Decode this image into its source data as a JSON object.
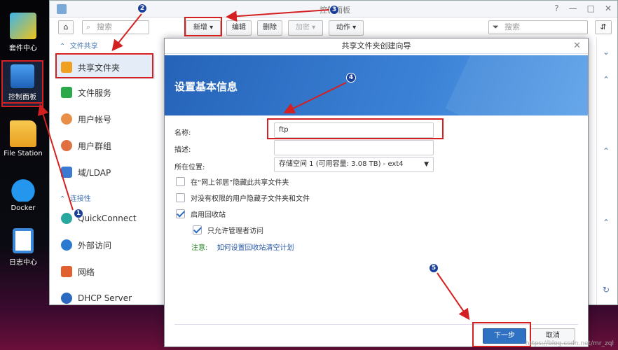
{
  "desktop": [
    {
      "label": "套件中心",
      "icon": "package-center-icon",
      "color": "#f0c419"
    },
    {
      "label": "控制面板",
      "icon": "control-panel-icon",
      "color": "#2e7fd6"
    },
    {
      "label": "File Station",
      "icon": "folder-icon",
      "color": "#f2b632"
    },
    {
      "label": "Docker",
      "icon": "docker-whale-icon",
      "color": "#2496ed"
    },
    {
      "label": "日志中心",
      "icon": "log-center-icon",
      "color": "#3a86d8"
    }
  ],
  "window": {
    "title": "控制面板",
    "controls": [
      "?",
      "—",
      "□",
      "✕"
    ]
  },
  "toolbar": {
    "search_placeholder": "搜索",
    "buttons": [
      {
        "label": "新增 ▾"
      },
      {
        "label": "编辑"
      },
      {
        "label": "删除"
      },
      {
        "label": "加密 ▾"
      },
      {
        "label": "动作 ▾"
      }
    ],
    "filter_placeholder": "搜索"
  },
  "sidebar": {
    "sections": [
      "文件共享",
      "连接性"
    ],
    "items": [
      {
        "label": "共享文件夹",
        "color": "#f0a020"
      },
      {
        "label": "文件服务",
        "color": "#2aa84a"
      },
      {
        "label": "用户帐号",
        "color": "#e8904a"
      },
      {
        "label": "用户群组",
        "color": "#e07040"
      },
      {
        "label": "域/LDAP",
        "color": "#3a7ad0"
      },
      {
        "label": "QuickConnect",
        "color": "#2aa8a0"
      },
      {
        "label": "外部访问",
        "color": "#2a7ad0"
      },
      {
        "label": "网络",
        "color": "#e06030"
      },
      {
        "label": "DHCP Server",
        "color": "#2a6ac0"
      }
    ]
  },
  "dialog": {
    "title": "共享文件夹创建向导",
    "banner_heading": "设置基本信息",
    "name_label": "名称:",
    "name_value": "ftp",
    "desc_label": "描述:",
    "desc_value": "",
    "location_label": "所在位置:",
    "location_value": "存储空间 1 (可用容量: 3.08 TB) - ext4",
    "checkboxes": [
      {
        "label": "在“网上邻居”隐藏此共享文件夹",
        "checked": false
      },
      {
        "label": "对没有权限的用户隐藏子文件夹和文件",
        "checked": false
      },
      {
        "label": "启用回收站",
        "checked": true
      },
      {
        "label": "只允许管理者访问",
        "checked": true
      }
    ],
    "note_key": "注意:",
    "note_link": "如何设置回收站清空计划",
    "next_label": "下一步",
    "cancel_label": "取消"
  },
  "annotations": [
    "1",
    "2",
    "3",
    "4",
    "5"
  ],
  "watermark": "https://blog.csdn.net/mr_zql"
}
